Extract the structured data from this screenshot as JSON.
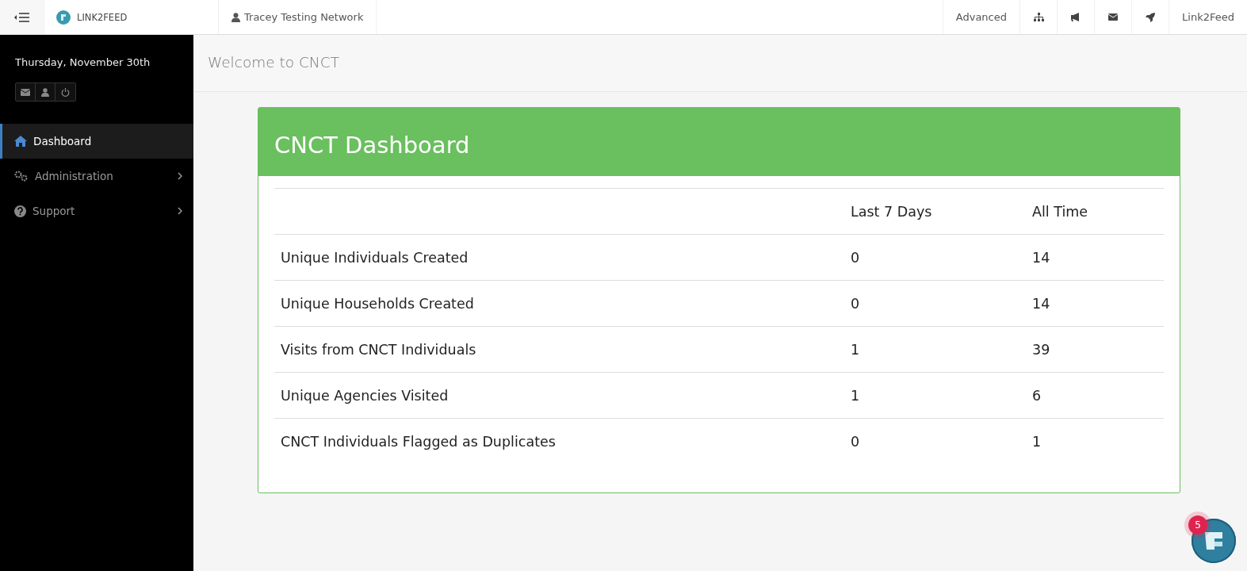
{
  "topbar": {
    "brand": "LINK2FEED",
    "network": "Tracey Testing Network",
    "advanced_link": "Advanced",
    "account_link": "Link2Feed"
  },
  "sidebar": {
    "date": "Thursday, November 30th",
    "items": [
      {
        "label": "Dashboard",
        "kind": "link",
        "selected": true
      },
      {
        "label": "Administration",
        "kind": "submenu",
        "selected": false
      },
      {
        "label": "Support",
        "kind": "submenu",
        "selected": false
      }
    ]
  },
  "page_title": "Welcome to CNCT",
  "card": {
    "title": "CNCT Dashboard",
    "columns": [
      "Last 7 Days",
      "All Time"
    ],
    "rows": [
      {
        "label": "Unique Individuals Created",
        "values": [
          "0",
          "14"
        ]
      },
      {
        "label": "Unique Households Created",
        "values": [
          "0",
          "14"
        ]
      },
      {
        "label": "Visits from CNCT Individuals",
        "values": [
          "1",
          "39"
        ]
      },
      {
        "label": "Unique Agencies Visited",
        "values": [
          "1",
          "6"
        ]
      },
      {
        "label": "CNCT Individuals Flagged as Duplicates",
        "values": [
          "0",
          "1"
        ]
      }
    ]
  },
  "help_badge": "5"
}
